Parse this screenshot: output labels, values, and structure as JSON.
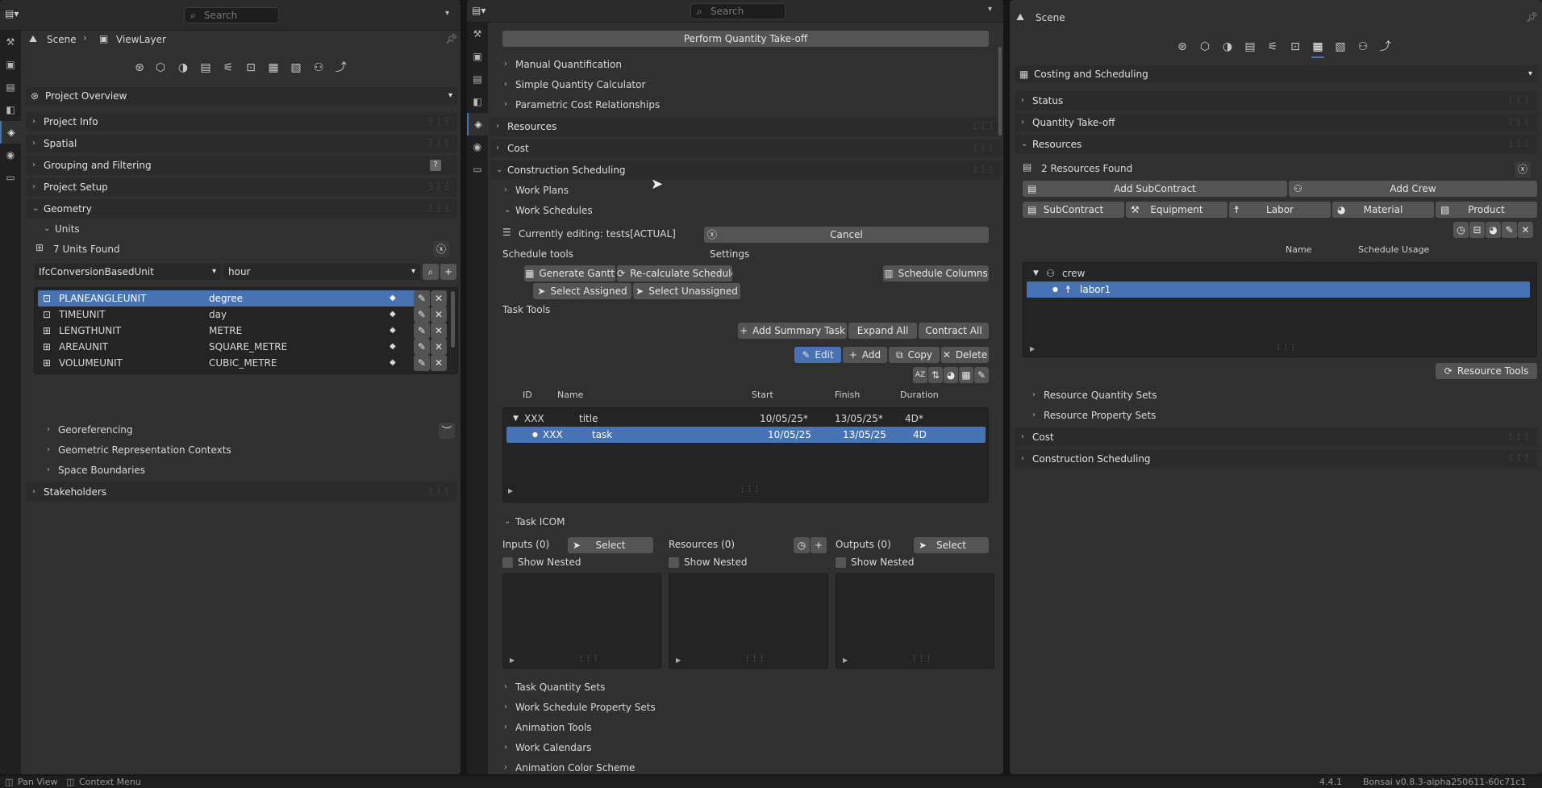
{
  "left": {
    "search_placeholder": "Search",
    "breadcrumb": {
      "scene": "Scene",
      "viewlayer": "ViewLayer"
    },
    "dropdown": "Project Overview",
    "panels": {
      "project_info": "Project Info",
      "spatial": "Spatial",
      "grouping": "Grouping and Filtering",
      "project_setup": "Project Setup",
      "geometry": "Geometry",
      "units": "Units",
      "georef": "Georeferencing",
      "geo_contexts": "Geometric Representation Contexts",
      "space_boundaries": "Space Boundaries",
      "stakeholders": "Stakeholders"
    },
    "units_found": "7 Units Found",
    "unit_type": "IfcConversionBasedUnit",
    "unit_name": "hour",
    "units": [
      {
        "name": "PLANEANGLEUNIT",
        "value": "degree"
      },
      {
        "name": "TIMEUNIT",
        "value": "day"
      },
      {
        "name": "LENGTHUNIT",
        "value": "METRE"
      },
      {
        "name": "AREAUNIT",
        "value": "SQUARE_METRE"
      },
      {
        "name": "VOLUMEUNIT",
        "value": "CUBIC_METRE"
      }
    ]
  },
  "middle": {
    "search_placeholder": "Search",
    "take_off_btn": "Perform Quantity Take-off",
    "subs": {
      "manual": "Manual Quantification",
      "simple": "Simple Quantity Calculator",
      "parametric": "Parametric Cost Relationships",
      "work_plans": "Work Plans",
      "work_schedules": "Work Schedules",
      "task_icom": "Task ICOM",
      "task_qsets": "Task Quantity Sets",
      "ws_psets": "Work Schedule Property Sets",
      "anim_tools": "Animation Tools",
      "work_calendars": "Work Calendars",
      "anim_color": "Animation Color Scheme"
    },
    "panels": {
      "resources": "Resources",
      "cost": "Cost",
      "construction": "Construction Scheduling"
    },
    "editing": "Currently editing: tests[ACTUAL]",
    "cancel": "Cancel",
    "schedule_tools": "Schedule tools",
    "settings": "Settings",
    "btns": {
      "gantt": "Generate Gantt",
      "recalc": "Re-calculate Schedule",
      "schedule_columns": "Schedule Columns",
      "select_assigned": "Select Assigned",
      "select_unassigned": "Select Unassigned",
      "add_summary": "Add Summary Task",
      "expand_all": "Expand All",
      "contract_all": "Contract All",
      "edit": "Edit",
      "add": "Add",
      "copy": "Copy",
      "delete": "Delete"
    },
    "task_tools": "Task Tools",
    "cols": {
      "id": "ID",
      "name": "Name",
      "start": "Start",
      "finish": "Finish",
      "duration": "Duration"
    },
    "tasks": [
      {
        "id": "XXX",
        "name": "title",
        "start": "10/05/25*",
        "finish": "13/05/25*",
        "duration": "4D*"
      },
      {
        "id": "XXX",
        "name": "task",
        "start": "10/05/25",
        "finish": "13/05/25",
        "duration": "4D"
      }
    ],
    "icom": {
      "inputs": "Inputs (0)",
      "resources": "Resources (0)",
      "outputs": "Outputs (0)",
      "select": "Select",
      "show_nested": "Show Nested"
    }
  },
  "right": {
    "scene": "Scene",
    "dropdown": "Costing and Scheduling",
    "panels": {
      "status": "Status",
      "qto": "Quantity Take-off",
      "resources": "Resources",
      "cost": "Cost",
      "construction": "Construction Scheduling"
    },
    "found": "2 Resources Found",
    "add_subcontract": "Add SubContract",
    "add_crew": "Add Crew",
    "types": [
      "SubContract",
      "Equipment",
      "Labor",
      "Material",
      "Product"
    ],
    "cols": {
      "name": "Name",
      "usage": "Schedule Usage"
    },
    "tree": [
      {
        "name": "crew"
      },
      {
        "name": "labor1"
      }
    ],
    "resource_tools": "Resource Tools",
    "subs": {
      "qsets": "Resource Quantity Sets",
      "psets": "Resource Property Sets"
    }
  },
  "statusbar": {
    "pan": "Pan View",
    "context": "Context Menu",
    "version_short": "4.4.1",
    "version": "Bonsai v0.8.3-alpha250611-60c71c1"
  }
}
